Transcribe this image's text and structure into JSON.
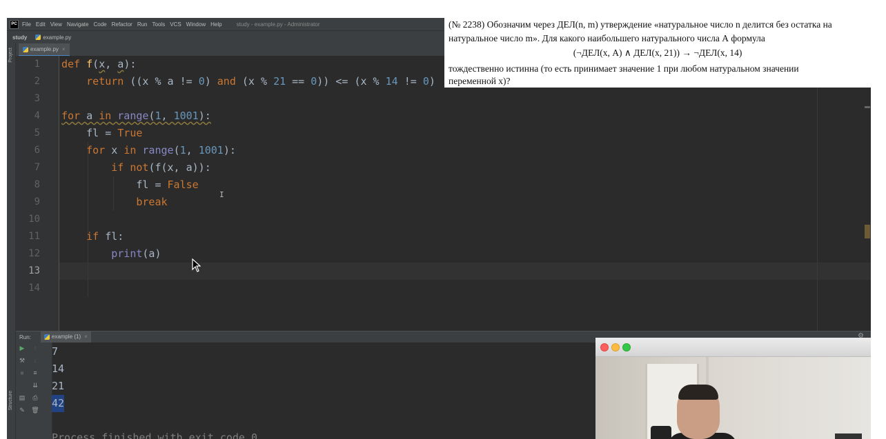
{
  "menubar": {
    "logo": "PC",
    "items": [
      "File",
      "Edit",
      "View",
      "Navigate",
      "Code",
      "Refactor",
      "Run",
      "Tools",
      "VCS",
      "Window",
      "Help"
    ],
    "window_title": "study - example.py - Administrator"
  },
  "navbar": {
    "project": "study",
    "file": "example.py"
  },
  "leftstrip": {
    "project_label": "Project",
    "structure_label": "Structure"
  },
  "editor": {
    "tab": "example.py",
    "current_line": 13,
    "line_numbers": [
      "1",
      "2",
      "3",
      "4",
      "5",
      "6",
      "7",
      "8",
      "9",
      "10",
      "11",
      "12",
      "13",
      "14"
    ]
  },
  "run_panel": {
    "label": "Run:",
    "tab": "example (1)",
    "output": [
      "7",
      "14",
      "21",
      "42"
    ],
    "selected_output": "42",
    "footer": "Process finished with exit code 0"
  },
  "task": {
    "line1": "(№ 2238) Обозначим через ДЕЛ(n, m) утверждение «натуральное число n делится без остатка на",
    "line2": "натуральное число m». Для какого наибольшего натурального числа А формула",
    "formula": "(¬ДЕЛ(x, А) ∧ ДЕЛ(x, 21)) → ¬ДЕЛ(x, 14)",
    "line3": "тождественно истинна (то есть принимает значение 1 при любом натуральном значении",
    "line4": "переменной х)?"
  },
  "colors": {
    "keyword": "#cc7832",
    "function": "#ffc66d",
    "number": "#6897bb",
    "builtin": "#8888c6",
    "text": "#a9b7c6",
    "selection": "#214283"
  }
}
